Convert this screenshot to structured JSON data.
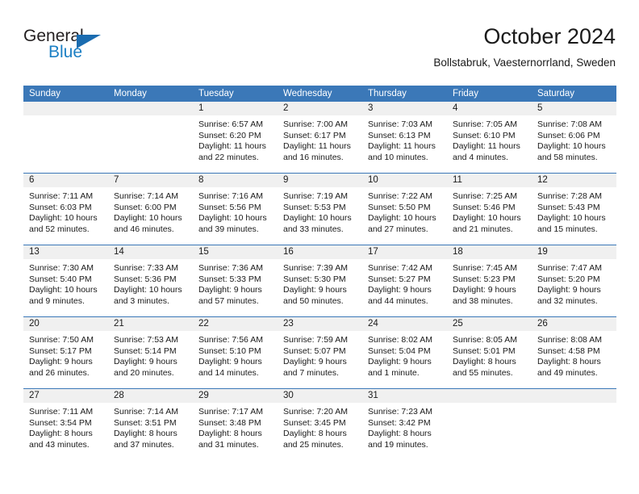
{
  "brand": {
    "name_top": "General",
    "name_bottom": "Blue",
    "triangle_icon": "triangle-icon",
    "color_dark": "#231f20",
    "color_blue": "#1b7fc4"
  },
  "header": {
    "title": "October 2024",
    "subtitle": "Bollstabruk, Vaesternorrland, Sweden"
  },
  "theme": {
    "header_blue": "#3b78b8",
    "daynum_band": "#f0f0f0",
    "text": "#1a1a1a"
  },
  "calendar": {
    "weekday_headers": [
      "Sunday",
      "Monday",
      "Tuesday",
      "Wednesday",
      "Thursday",
      "Friday",
      "Saturday"
    ],
    "weeks": [
      [
        {
          "day": "",
          "empty": true
        },
        {
          "day": "",
          "empty": true
        },
        {
          "day": "1",
          "sunrise": "Sunrise: 6:57 AM",
          "sunset": "Sunset: 6:20 PM",
          "daylight": "Daylight: 11 hours and 22 minutes."
        },
        {
          "day": "2",
          "sunrise": "Sunrise: 7:00 AM",
          "sunset": "Sunset: 6:17 PM",
          "daylight": "Daylight: 11 hours and 16 minutes."
        },
        {
          "day": "3",
          "sunrise": "Sunrise: 7:03 AM",
          "sunset": "Sunset: 6:13 PM",
          "daylight": "Daylight: 11 hours and 10 minutes."
        },
        {
          "day": "4",
          "sunrise": "Sunrise: 7:05 AM",
          "sunset": "Sunset: 6:10 PM",
          "daylight": "Daylight: 11 hours and 4 minutes."
        },
        {
          "day": "5",
          "sunrise": "Sunrise: 7:08 AM",
          "sunset": "Sunset: 6:06 PM",
          "daylight": "Daylight: 10 hours and 58 minutes."
        }
      ],
      [
        {
          "day": "6",
          "sunrise": "Sunrise: 7:11 AM",
          "sunset": "Sunset: 6:03 PM",
          "daylight": "Daylight: 10 hours and 52 minutes."
        },
        {
          "day": "7",
          "sunrise": "Sunrise: 7:14 AM",
          "sunset": "Sunset: 6:00 PM",
          "daylight": "Daylight: 10 hours and 46 minutes."
        },
        {
          "day": "8",
          "sunrise": "Sunrise: 7:16 AM",
          "sunset": "Sunset: 5:56 PM",
          "daylight": "Daylight: 10 hours and 39 minutes."
        },
        {
          "day": "9",
          "sunrise": "Sunrise: 7:19 AM",
          "sunset": "Sunset: 5:53 PM",
          "daylight": "Daylight: 10 hours and 33 minutes."
        },
        {
          "day": "10",
          "sunrise": "Sunrise: 7:22 AM",
          "sunset": "Sunset: 5:50 PM",
          "daylight": "Daylight: 10 hours and 27 minutes."
        },
        {
          "day": "11",
          "sunrise": "Sunrise: 7:25 AM",
          "sunset": "Sunset: 5:46 PM",
          "daylight": "Daylight: 10 hours and 21 minutes."
        },
        {
          "day": "12",
          "sunrise": "Sunrise: 7:28 AM",
          "sunset": "Sunset: 5:43 PM",
          "daylight": "Daylight: 10 hours and 15 minutes."
        }
      ],
      [
        {
          "day": "13",
          "sunrise": "Sunrise: 7:30 AM",
          "sunset": "Sunset: 5:40 PM",
          "daylight": "Daylight: 10 hours and 9 minutes."
        },
        {
          "day": "14",
          "sunrise": "Sunrise: 7:33 AM",
          "sunset": "Sunset: 5:36 PM",
          "daylight": "Daylight: 10 hours and 3 minutes."
        },
        {
          "day": "15",
          "sunrise": "Sunrise: 7:36 AM",
          "sunset": "Sunset: 5:33 PM",
          "daylight": "Daylight: 9 hours and 57 minutes."
        },
        {
          "day": "16",
          "sunrise": "Sunrise: 7:39 AM",
          "sunset": "Sunset: 5:30 PM",
          "daylight": "Daylight: 9 hours and 50 minutes."
        },
        {
          "day": "17",
          "sunrise": "Sunrise: 7:42 AM",
          "sunset": "Sunset: 5:27 PM",
          "daylight": "Daylight: 9 hours and 44 minutes."
        },
        {
          "day": "18",
          "sunrise": "Sunrise: 7:45 AM",
          "sunset": "Sunset: 5:23 PM",
          "daylight": "Daylight: 9 hours and 38 minutes."
        },
        {
          "day": "19",
          "sunrise": "Sunrise: 7:47 AM",
          "sunset": "Sunset: 5:20 PM",
          "daylight": "Daylight: 9 hours and 32 minutes."
        }
      ],
      [
        {
          "day": "20",
          "sunrise": "Sunrise: 7:50 AM",
          "sunset": "Sunset: 5:17 PM",
          "daylight": "Daylight: 9 hours and 26 minutes."
        },
        {
          "day": "21",
          "sunrise": "Sunrise: 7:53 AM",
          "sunset": "Sunset: 5:14 PM",
          "daylight": "Daylight: 9 hours and 20 minutes."
        },
        {
          "day": "22",
          "sunrise": "Sunrise: 7:56 AM",
          "sunset": "Sunset: 5:10 PM",
          "daylight": "Daylight: 9 hours and 14 minutes."
        },
        {
          "day": "23",
          "sunrise": "Sunrise: 7:59 AM",
          "sunset": "Sunset: 5:07 PM",
          "daylight": "Daylight: 9 hours and 7 minutes."
        },
        {
          "day": "24",
          "sunrise": "Sunrise: 8:02 AM",
          "sunset": "Sunset: 5:04 PM",
          "daylight": "Daylight: 9 hours and 1 minute."
        },
        {
          "day": "25",
          "sunrise": "Sunrise: 8:05 AM",
          "sunset": "Sunset: 5:01 PM",
          "daylight": "Daylight: 8 hours and 55 minutes."
        },
        {
          "day": "26",
          "sunrise": "Sunrise: 8:08 AM",
          "sunset": "Sunset: 4:58 PM",
          "daylight": "Daylight: 8 hours and 49 minutes."
        }
      ],
      [
        {
          "day": "27",
          "sunrise": "Sunrise: 7:11 AM",
          "sunset": "Sunset: 3:54 PM",
          "daylight": "Daylight: 8 hours and 43 minutes."
        },
        {
          "day": "28",
          "sunrise": "Sunrise: 7:14 AM",
          "sunset": "Sunset: 3:51 PM",
          "daylight": "Daylight: 8 hours and 37 minutes."
        },
        {
          "day": "29",
          "sunrise": "Sunrise: 7:17 AM",
          "sunset": "Sunset: 3:48 PM",
          "daylight": "Daylight: 8 hours and 31 minutes."
        },
        {
          "day": "30",
          "sunrise": "Sunrise: 7:20 AM",
          "sunset": "Sunset: 3:45 PM",
          "daylight": "Daylight: 8 hours and 25 minutes."
        },
        {
          "day": "31",
          "sunrise": "Sunrise: 7:23 AM",
          "sunset": "Sunset: 3:42 PM",
          "daylight": "Daylight: 8 hours and 19 minutes."
        },
        {
          "day": "",
          "empty": true
        },
        {
          "day": "",
          "empty": true
        }
      ]
    ]
  }
}
